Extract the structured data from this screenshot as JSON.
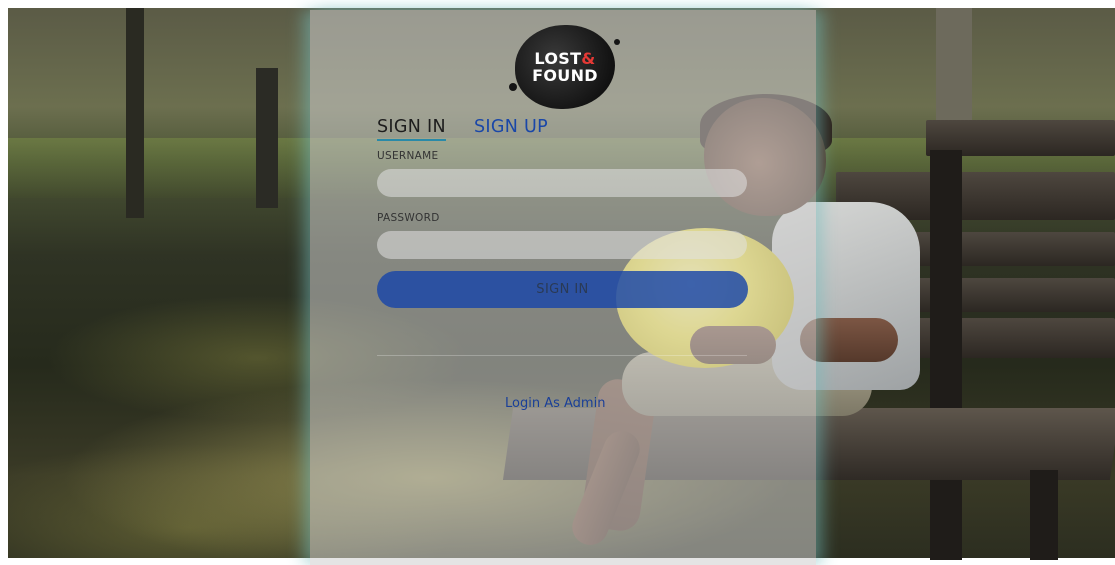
{
  "logo": {
    "line1": "LOST",
    "amp": "&",
    "line2": "FOUND"
  },
  "tabs": [
    {
      "label": "SIGN IN",
      "active": true
    },
    {
      "label": "SIGN UP",
      "active": false
    }
  ],
  "form": {
    "username_label": "USERNAME",
    "username_value": "",
    "password_label": "PASSWORD",
    "password_value": "",
    "submit_label": "SIGN IN"
  },
  "admin_link": "Login As Admin",
  "colors": {
    "accent_blue": "#1a47a8",
    "button_blue": "#1846a8",
    "tab_underline": "#2a8aa8",
    "logo_red": "#e53935"
  },
  "background": {
    "icon": "park-photo-boy-with-balloon-on-bench"
  }
}
